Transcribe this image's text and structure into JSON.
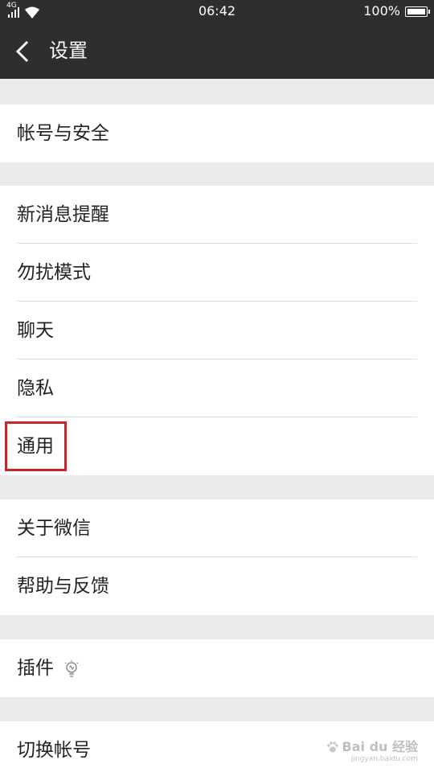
{
  "status_bar": {
    "network": "4G",
    "time": "06:42",
    "battery": "100%"
  },
  "header": {
    "title": "设置"
  },
  "groups": [
    {
      "items": [
        {
          "label": "帐号与安全"
        }
      ]
    },
    {
      "items": [
        {
          "label": "新消息提醒"
        },
        {
          "label": "勿扰模式"
        },
        {
          "label": "聊天"
        },
        {
          "label": "隐私"
        },
        {
          "label": "通用"
        }
      ]
    },
    {
      "items": [
        {
          "label": "关于微信"
        },
        {
          "label": "帮助与反馈"
        }
      ]
    },
    {
      "items": [
        {
          "label": "插件"
        }
      ]
    },
    {
      "items": [
        {
          "label": "切换帐号"
        }
      ]
    }
  ],
  "highlighted_item": "通用",
  "watermark": {
    "brand": "Bai du 经验",
    "url": "jingyan.baidu.com"
  },
  "colors": {
    "app_bar": "#2e2e2e",
    "background": "#ebebeb",
    "highlight": "#c8232c"
  }
}
